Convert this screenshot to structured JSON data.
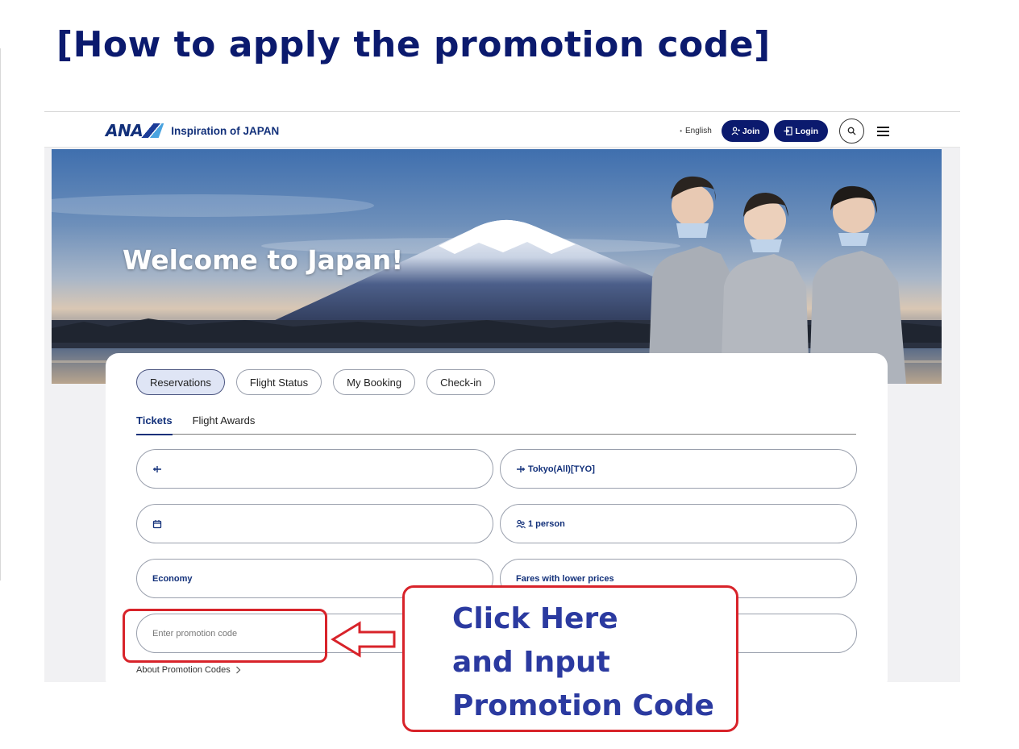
{
  "slide": {
    "title": "[How to apply the promotion code]"
  },
  "header": {
    "logo_text": "ANA",
    "tagline": "Inspiration of JAPAN",
    "language": "English",
    "join_label": "Join",
    "login_label": "Login"
  },
  "hero": {
    "welcome": "Welcome to Japan!"
  },
  "booking": {
    "tabs": [
      {
        "label": "Reservations",
        "active": true
      },
      {
        "label": "Flight Status",
        "active": false
      },
      {
        "label": "My Booking",
        "active": false
      },
      {
        "label": "Check-in",
        "active": false
      }
    ],
    "subtabs": [
      {
        "label": "Tickets",
        "active": true
      },
      {
        "label": "Flight Awards",
        "active": false
      }
    ],
    "fields": {
      "from_value": "",
      "to_value": "Tokyo(All)[TYO]",
      "date_value": "",
      "passengers_value": "1 person",
      "cabin_value": "Economy",
      "fare_value": "Fares with lower prices",
      "promo_placeholder": "Enter promotion code",
      "extra_value": ""
    },
    "about_promo": "About Promotion Codes"
  },
  "annotation": {
    "callout_lines": [
      "Click Here",
      "and Input",
      "Promotion Code"
    ],
    "accent_color": "#d8232a",
    "text_color": "#2b3aa0"
  },
  "colors": {
    "brand_navy": "#0b1a6e",
    "brand_blue": "#12307a"
  }
}
